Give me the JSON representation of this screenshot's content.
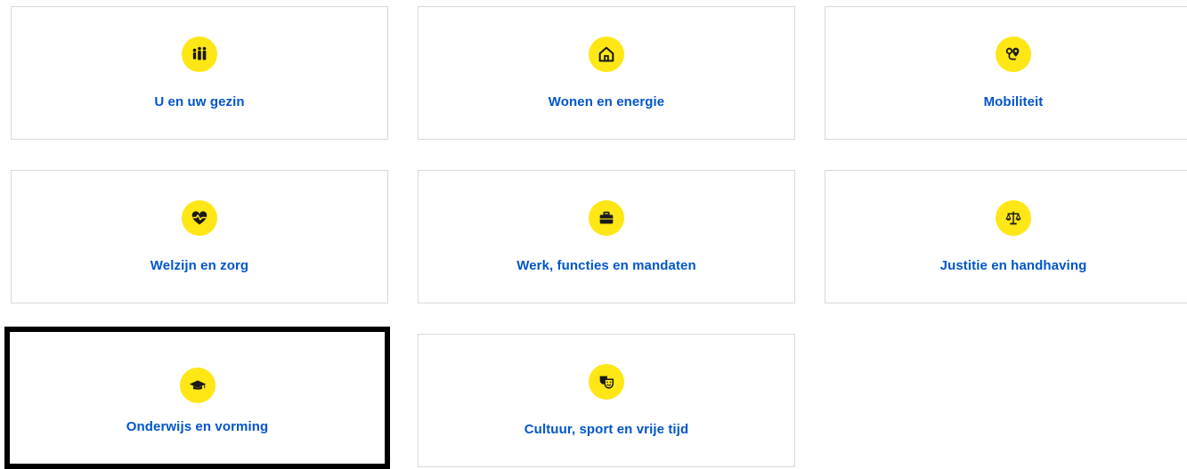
{
  "tiles": [
    {
      "label": "U en uw gezin",
      "icon": "family-icon"
    },
    {
      "label": "Wonen en energie",
      "icon": "house-icon"
    },
    {
      "label": "Mobiliteit",
      "icon": "route-icon"
    },
    {
      "label": "Welzijn en zorg",
      "icon": "heart-pulse-icon"
    },
    {
      "label": "Werk, functies en mandaten",
      "icon": "briefcase-icon"
    },
    {
      "label": "Justitie en handhaving",
      "icon": "scales-icon"
    },
    {
      "label": "Onderwijs en vorming",
      "icon": "graduation-cap-icon"
    },
    {
      "label": "Cultuur, sport en vrije tijd",
      "icon": "theatre-masks-icon"
    }
  ],
  "colors": {
    "accent_yellow": "#ffe615",
    "link_blue": "#0055cc",
    "tile_border": "#d9d9d9",
    "focus_outline": "#000000"
  },
  "focused_tile": "Onderwijs en vorming"
}
